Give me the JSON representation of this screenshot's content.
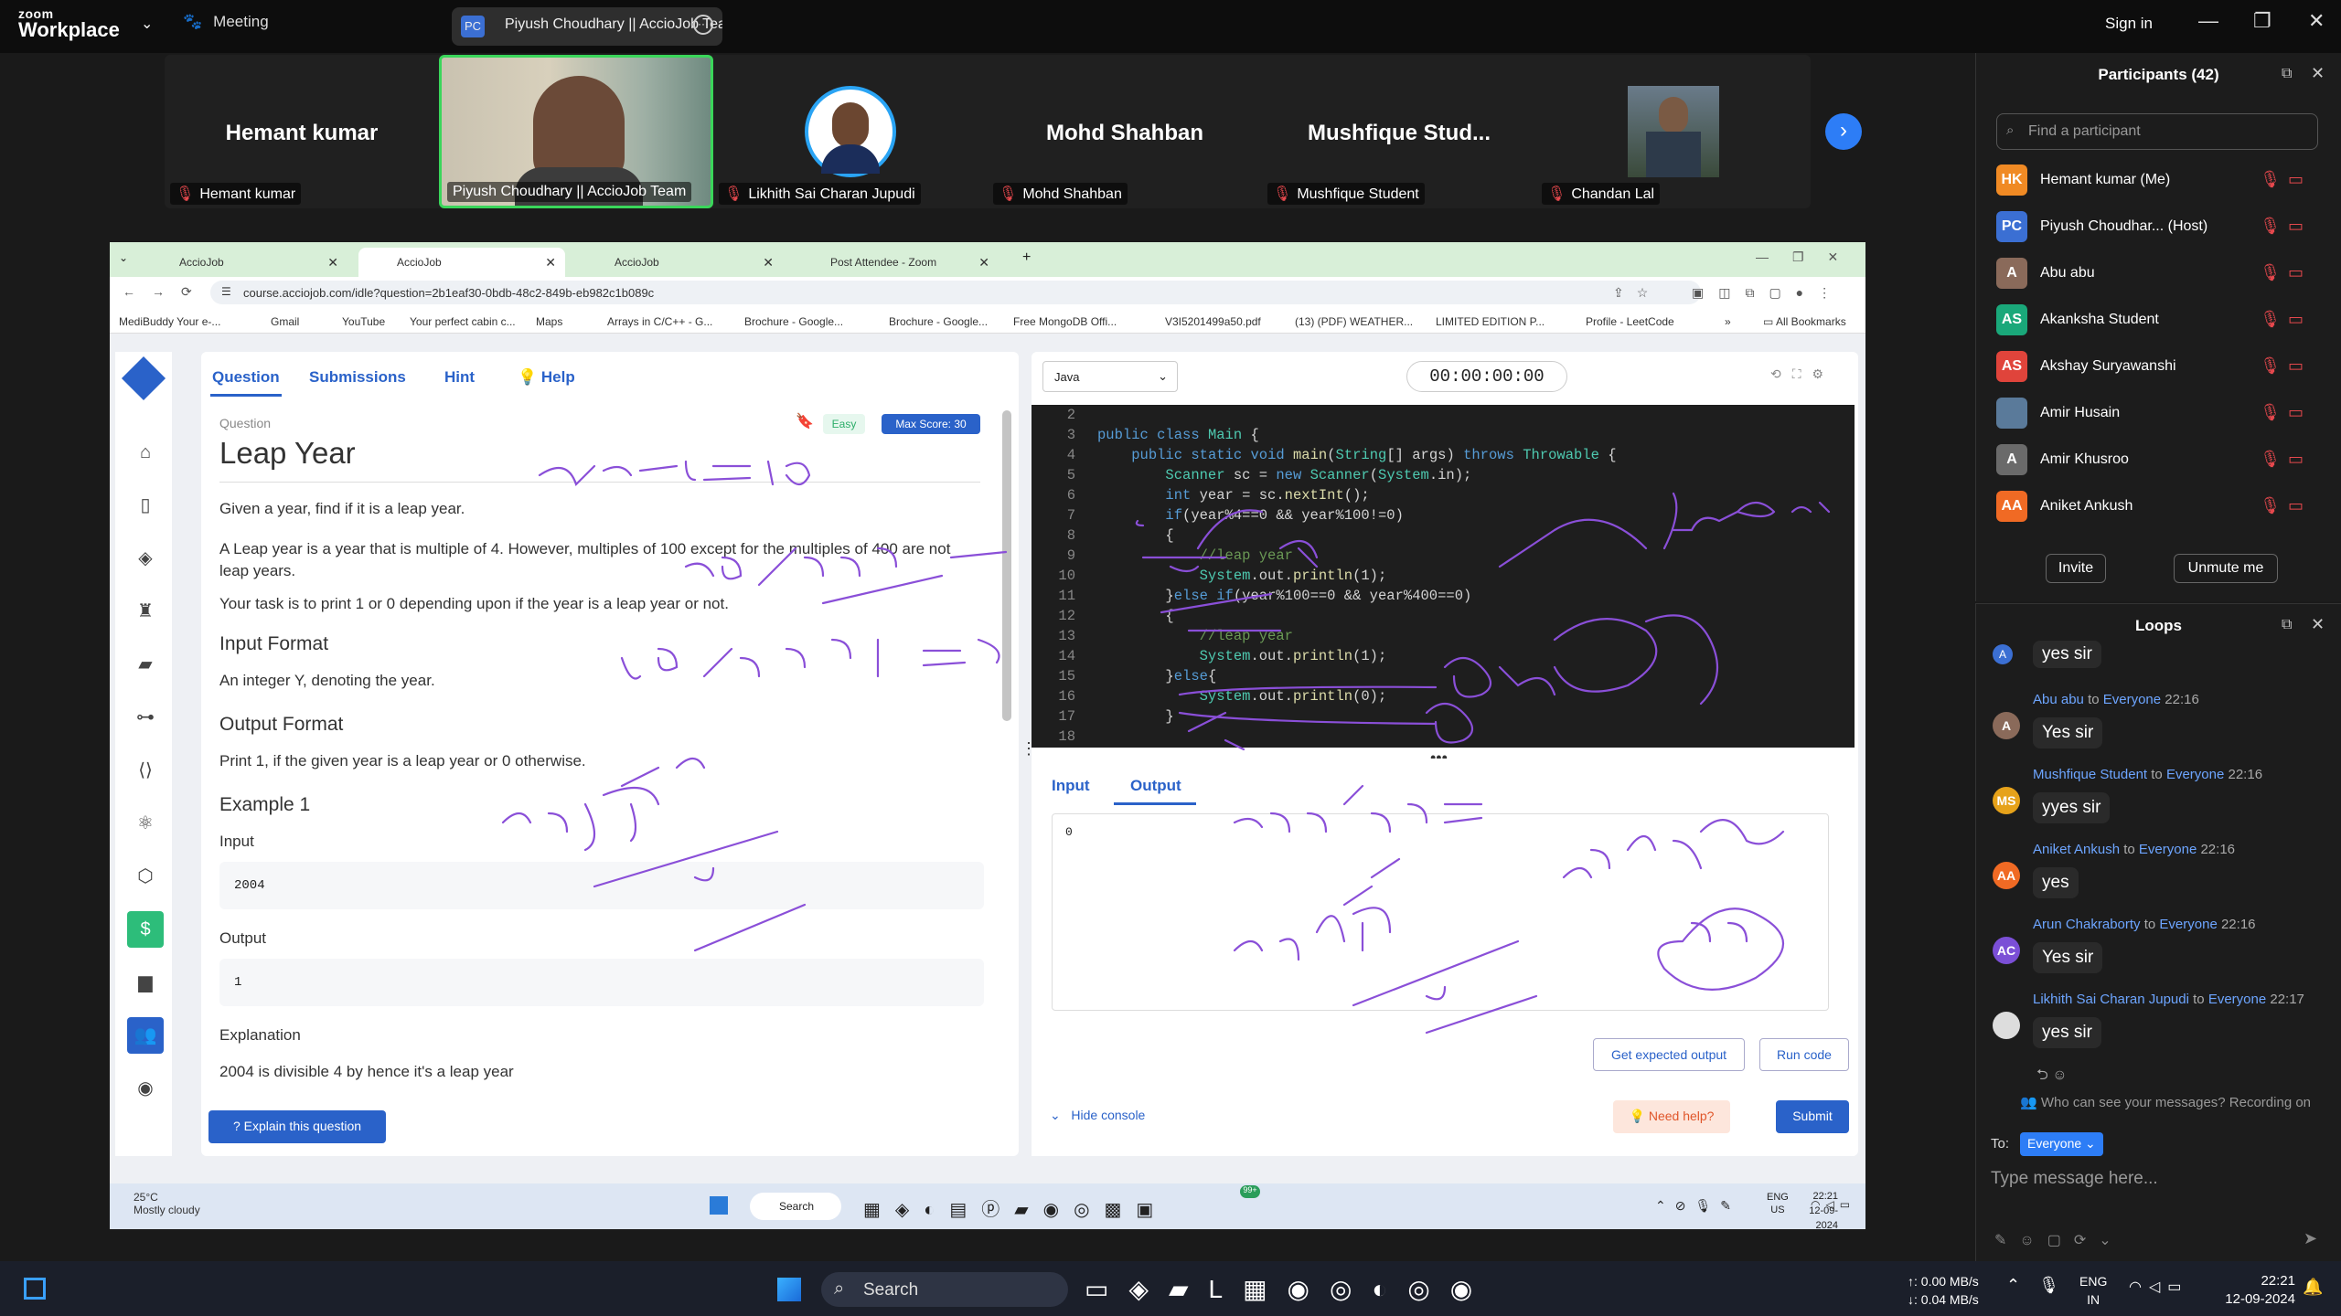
{
  "zoom": {
    "brand_small": "zoom",
    "brand_big": "Workplace",
    "meeting": "Meeting",
    "share_title": "Piyush Choudhary || AccioJob Tea",
    "share_initials": "PC",
    "signin": "Sign in"
  },
  "tiles": [
    {
      "name": "Hemant kumar",
      "label": "Hemant kumar"
    },
    {
      "name": "",
      "label": "Piyush Choudhary || AccioJob Team"
    },
    {
      "name": "",
      "label": "Likhith Sai Charan Jupudi"
    },
    {
      "name": "Mohd Shahban",
      "label": "Mohd Shahban"
    },
    {
      "name": "Mushfique  Stud...",
      "label": "Mushfique Student"
    },
    {
      "name": "",
      "label": "Chandan Lal"
    }
  ],
  "participants": {
    "title": "Participants (42)",
    "search_placeholder": "Find a participant",
    "invite": "Invite",
    "unmute": "Unmute me",
    "list": [
      {
        "initials": "HK",
        "name": "Hemant kumar (Me)",
        "color": "#f08a24"
      },
      {
        "initials": "PC",
        "name": "Piyush Choudhar... (Host)",
        "color": "#3b6fd3"
      },
      {
        "initials": "A",
        "name": "Abu abu",
        "color": "#8a6a5a"
      },
      {
        "initials": "AS",
        "name": "Akanksha Student",
        "color": "#1aa87a"
      },
      {
        "initials": "AS",
        "name": "Akshay Suryawanshi",
        "color": "#e0443b"
      },
      {
        "initials": "",
        "name": "Amir Husain",
        "color": "#5a7a9a"
      },
      {
        "initials": "A",
        "name": "Amir Khusroo",
        "color": "#6a6a6a"
      },
      {
        "initials": "AA",
        "name": "Aniket Ankush",
        "color": "#f06a24"
      }
    ]
  },
  "chat": {
    "title": "Loops",
    "to_word": "to",
    "everyone": "Everyone",
    "top_message": "yes sir",
    "messages": [
      {
        "initials": "A",
        "from": "Abu abu",
        "time": "22:16",
        "text": "Yes sir",
        "color": "#8a6a5a"
      },
      {
        "initials": "MS",
        "from": "Mushfique Student",
        "time": "22:16",
        "text": "yyes sir",
        "color": "#e6a21a"
      },
      {
        "initials": "AA",
        "from": "Aniket Ankush",
        "time": "22:16",
        "text": "yes",
        "color": "#f06a24"
      },
      {
        "initials": "AC",
        "from": "Arun Chakraborty",
        "time": "22:16",
        "text": "Yes sir",
        "color": "#7b4fd6"
      },
      {
        "initials": "",
        "from": "Likhith Sai Charan Jupudi",
        "time": "22:17",
        "text": "yes sir",
        "color": "#ddd"
      }
    ],
    "visibility_note": "Who can see your messages? Recording on",
    "to_label": "To:",
    "to_value": "Everyone",
    "input_placeholder": "Type message here..."
  },
  "browser": {
    "tabs": [
      "AccioJob",
      "AccioJob",
      "AccioJob",
      "Post Attendee - Zoom"
    ],
    "url": "course.acciojob.com/idle?question=2b1eaf30-0bdb-48c2-849b-eb982c1b089c",
    "bookmarks": [
      "MediBuddy Your e-...",
      "Gmail",
      "YouTube",
      "Your perfect cabin c...",
      "Maps",
      "Arrays in C/C++ - G...",
      "Brochure - Google...",
      "Brochure - Google...",
      "Free MongoDB Offi...",
      "V3I5201499a50.pdf",
      "(13) (PDF) WEATHER...",
      "LIMITED EDITION P...",
      "Profile - LeetCode"
    ],
    "all_bookmarks": "All Bookmarks"
  },
  "question": {
    "tabs": [
      "Question",
      "Submissions",
      "Hint",
      "Help"
    ],
    "section_label": "Question",
    "difficulty": "Easy",
    "max_score": "Max Score: 30",
    "title": "Leap Year",
    "p1": "Given a year, find if it is a leap year.",
    "p2": "A Leap year is a year that is multiple of 4. However, multiples of 100 except for the multiples of 400 are not leap years.",
    "p3": "Your task is to print 1 or 0 depending upon if the year is a leap year or not.",
    "input_format_h": "Input Format",
    "input_format": "An integer Y, denoting the year.",
    "output_format_h": "Output Format",
    "output_format": "Print 1, if the given year is a leap year or 0 otherwise.",
    "example_h": "Example 1",
    "input_h": "Input",
    "input_val": "2004",
    "output_h": "Output",
    "output_val": "1",
    "explanation_h": "Explanation",
    "explanation": "2004 is divisible 4 by hence it's a leap year",
    "explain_btn": "Explain this question"
  },
  "editor": {
    "language": "Java",
    "timer": "00:00:00:00",
    "lines": [
      {
        "n": "2",
        "code": ""
      },
      {
        "n": "3",
        "code": "public class Main {"
      },
      {
        "n": "4",
        "code": "    public static void main(String[] args) throws Throwable {"
      },
      {
        "n": "5",
        "code": "        Scanner sc = new Scanner(System.in);"
      },
      {
        "n": "6",
        "code": "        int year = sc.nextInt();"
      },
      {
        "n": "7",
        "code": "        if(year%4==0 && year%100!=0)"
      },
      {
        "n": "8",
        "code": "        {"
      },
      {
        "n": "9",
        "code": "            //leap year"
      },
      {
        "n": "10",
        "code": "            System.out.println(1);"
      },
      {
        "n": "11",
        "code": "        }else if(year%100==0 && year%400==0)"
      },
      {
        "n": "12",
        "code": "        {"
      },
      {
        "n": "13",
        "code": "            //leap year"
      },
      {
        "n": "14",
        "code": "            System.out.println(1);"
      },
      {
        "n": "15",
        "code": "        }else{"
      },
      {
        "n": "16",
        "code": "            System.out.println(0);"
      },
      {
        "n": "17",
        "code": "        }"
      },
      {
        "n": "18",
        "code": ""
      }
    ],
    "console_tabs": [
      "Input",
      "Output"
    ],
    "output_value": "0",
    "expected_btn": "Get expected output",
    "run_btn": "Run code",
    "hide_console": "Hide console",
    "need_help": "Need help?",
    "submit": "Submit"
  },
  "inner_taskbar": {
    "weather_temp": "25°C",
    "weather_desc": "Mostly cloudy",
    "search": "Search",
    "lang1": "ENG",
    "lang2": "US",
    "time": "22:21",
    "date": "12-09-2024",
    "badge": "99+"
  },
  "outer_taskbar": {
    "search": "Search",
    "net_up": "↑: 0.00 MB/s",
    "net_down": "↓: 0.04 MB/s",
    "lang1": "ENG",
    "lang2": "IN",
    "time": "22:21",
    "date": "12-09-2024"
  },
  "accent": "#2a62c9"
}
